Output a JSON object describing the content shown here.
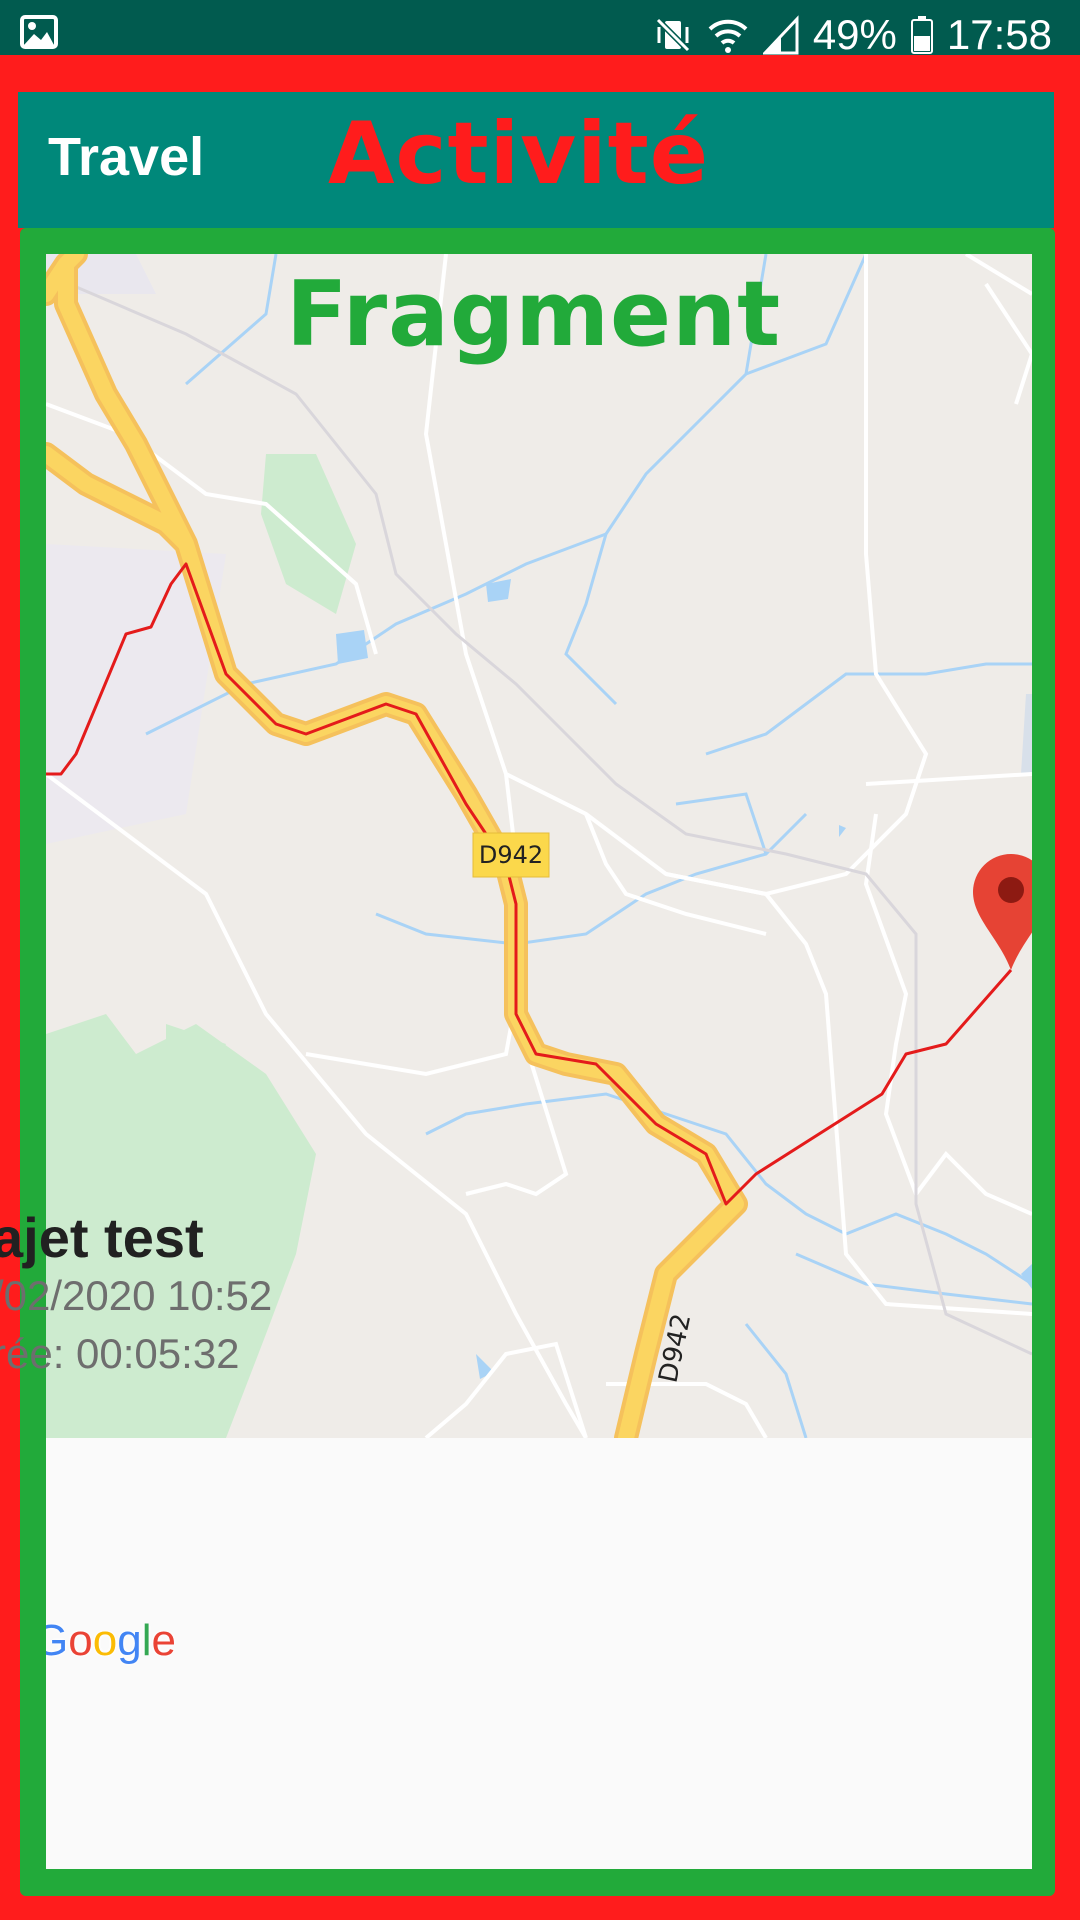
{
  "status_bar": {
    "battery": "49%",
    "time": "17:58",
    "icons": [
      "image-icon",
      "mute-vibrate-icon",
      "wifi-icon",
      "signal-icon",
      "battery-icon"
    ]
  },
  "toolbar": {
    "title": "Travel"
  },
  "overlay_labels": {
    "activity": "Activité",
    "fragment": "Fragment"
  },
  "map": {
    "road_labels": [
      "D942",
      "D942"
    ],
    "attribution": [
      "G",
      "o",
      "o",
      "g",
      "l",
      "e"
    ],
    "marker": "map-pin-icon"
  },
  "trip": {
    "title": "ajet test",
    "date": "/02/2020 10:52",
    "duration": "rée: 00:05:32"
  },
  "colors": {
    "status_bar": "#015b4f",
    "toolbar": "#00887a",
    "activity_frame": "#ff1c1c",
    "fragment_frame": "#22aa3a",
    "route": "#e41b1b",
    "highway": "#fbd561"
  }
}
